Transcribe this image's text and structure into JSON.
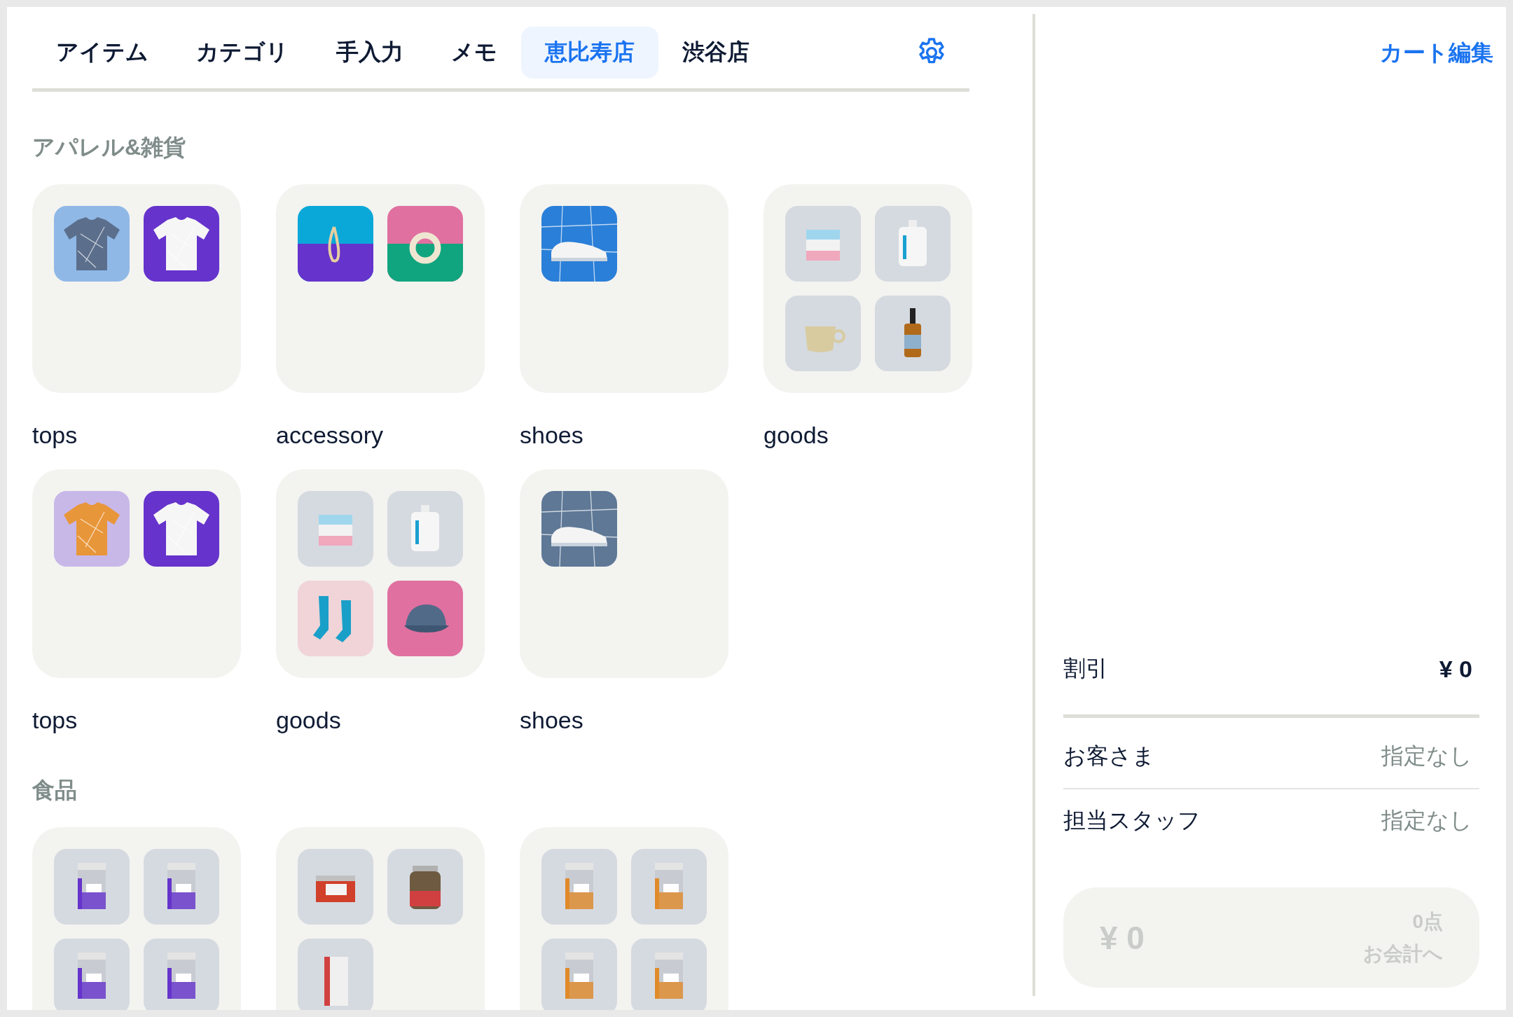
{
  "tabs": [
    {
      "label": "アイテム",
      "selected": false
    },
    {
      "label": "カテゴリ",
      "selected": false
    },
    {
      "label": "手入力",
      "selected": false
    },
    {
      "label": "メモ",
      "selected": false
    },
    {
      "label": "恵比寿店",
      "selected": true
    },
    {
      "label": "渋谷店",
      "selected": false
    }
  ],
  "sections": [
    {
      "heading": "アパレル&雑貨",
      "tiles": [
        {
          "label": "tops"
        },
        {
          "label": "accessory"
        },
        {
          "label": "shoes"
        },
        {
          "label": "goods"
        },
        {
          "label": "tops"
        },
        {
          "label": "goods"
        },
        {
          "label": "shoes"
        }
      ]
    },
    {
      "heading": "食品"
    }
  ],
  "cart": {
    "edit_link": "カート編集",
    "discount": {
      "label": "割引",
      "value": "¥ 0"
    },
    "rows": [
      {
        "label": "お客さま",
        "value": "指定なし"
      },
      {
        "label": "担当スタッフ",
        "value": "指定なし"
      }
    ],
    "checkout": {
      "total": "¥ 0",
      "count": "0点",
      "action": "お会計へ"
    }
  }
}
